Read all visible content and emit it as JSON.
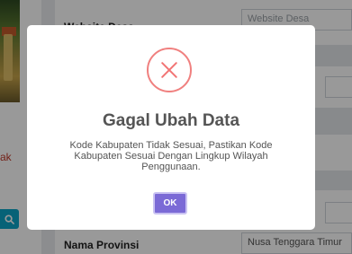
{
  "background": {
    "sidebar": {
      "side_text": "ak",
      "search_icon": "search-icon"
    },
    "form": {
      "website_label": "Website Desa",
      "website_placeholder": "Website Desa",
      "province_label": "Nama Provinsi",
      "province_value": "Nusa Tenggara Timur"
    }
  },
  "modal": {
    "icon": "error-x-icon",
    "title": "Gagal Ubah Data",
    "message": "Kode Kabupaten Tidak Sesuai, Pastikan Kode Kabupaten Sesuai Dengan Lingkup Wilayah Penggunaan.",
    "ok_label": "OK",
    "colors": {
      "icon": "#f27474",
      "button": "#7b6ad6",
      "overlay": "rgba(0,0,0,0.4)"
    }
  }
}
